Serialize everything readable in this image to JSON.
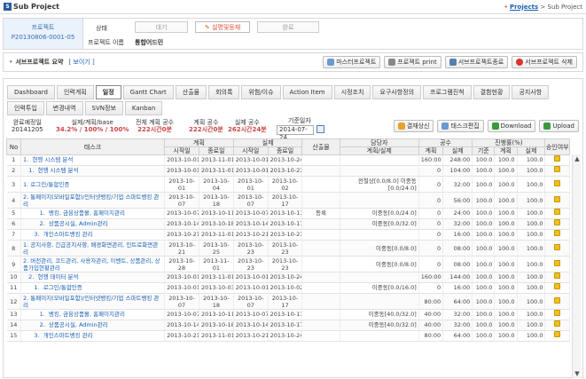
{
  "app": {
    "logo": "S",
    "title": "Sub Project"
  },
  "breadcrumb": {
    "link": "Projects",
    "sep": ">",
    "current": "Sub Project"
  },
  "project": {
    "label": "프로젝트",
    "code": "P20130806-0001-05",
    "status_label": "상태",
    "name_label": "프로젝트 이름",
    "name": "통합어드민",
    "steps": [
      "대기",
      "설명및등재",
      "완료"
    ],
    "active_step": 1
  },
  "summary": {
    "title": "서브프로젝트 요약",
    "show_link": "[ 보이기 ]",
    "buttons": [
      "마스터프로젝트",
      "프로젝트 print",
      "서브프로젝트종료",
      "서브프로젝트 삭제"
    ]
  },
  "tabs_row1": [
    "Dashboard",
    "인력계획",
    "일정",
    "Gantt Chart",
    "산출물",
    "회의록",
    "위험/이슈",
    "Action Item",
    "시정조치",
    "요구사항정의",
    "프로그램진척",
    "결함현황",
    "공지사항"
  ],
  "tabs_row2": [
    "인력투입",
    "변경내역",
    "SVN정보",
    "Kanban"
  ],
  "selected_tab": "일정",
  "stats": {
    "plan_end_label": "완료예정일",
    "plan_end": "20141205",
    "progress_label": "실제/계획/base",
    "progress": "34.2% / 100% / 100%",
    "total_label": "전체 계획 공수",
    "total": "222시간0분",
    "plan_label": "계획 공수",
    "plan": "222시간0분",
    "actual_label": "실제 공수",
    "actual": "262시간24분",
    "base_label": "기준일자",
    "base_date": "2014-07-24",
    "buttons": [
      "결재상신",
      "태스크편집",
      "Download",
      "Upload"
    ]
  },
  "table": {
    "headers": {
      "no": "No",
      "task": "태스크",
      "plan": "계획",
      "actual": "실제",
      "start": "시작일",
      "end": "종료일",
      "output": "산출물",
      "owner": "담당자",
      "owner_sub": "계획/실제",
      "effort": "공수",
      "effort_plan": "계획",
      "effort_actual": "실제",
      "progress": "진행률(%)",
      "p_base": "기준",
      "p_plan": "계획",
      "p_actual": "실제",
      "approve": "승인여부"
    },
    "rows": [
      {
        "no": "1",
        "task": "1.  현행 시스템 분석",
        "ps": "2013-10-01",
        "pe": "2013-11-01",
        "as": "2013-10-01",
        "ae": "2013-10-24",
        "out": "",
        "owner": "",
        "ep": "160:00",
        "ea": "248:00",
        "b": "100.0",
        "p": "100.0",
        "a": "100.0"
      },
      {
        "no": "2",
        "task": "   1.  현행 시스템 분석",
        "ps": "2013-10-01",
        "pe": "2013-11-01",
        "as": "2013-10-01",
        "ae": "2013-10-23",
        "out": "",
        "owner": "",
        "ep": "0",
        "ea": "104:00",
        "b": "100.0",
        "p": "100.0",
        "a": "100.0"
      },
      {
        "no": "3",
        "task": "      1.  로그인/통합인증",
        "ps": "2013-10-01",
        "pe": "2013-10-04",
        "as": "2013-10-01",
        "ae": "2013-10-02",
        "out": "",
        "owner": "전철상[0.0/8.0] 이중동[0.0/24.0]",
        "ep": "0",
        "ea": "32:00",
        "b": "100.0",
        "p": "100.0",
        "a": "100.0"
      },
      {
        "no": "4",
        "task": "      2.  통페이지(모바일포함)/인터넷뱅킹/기업 스마트뱅킹 관리",
        "ps": "2013-10-07",
        "pe": "2013-10-18",
        "as": "2013-10-07",
        "ae": "2013-10-17",
        "out": "",
        "owner": "",
        "ep": "0",
        "ea": "56:00",
        "b": "100.0",
        "p": "100.0",
        "a": "100.0"
      },
      {
        "no": "5",
        "task": "         1.  뱅킹, 금융상품몰, 홈페이지관리",
        "ps": "2013-10-07",
        "pe": "2013-10-11",
        "as": "2013-10-07",
        "ae": "2013-10-11",
        "out": "등록",
        "owner": "이중동[0.0/24.0]",
        "ep": "0",
        "ea": "24:00",
        "b": "100.0",
        "p": "100.0",
        "a": "100.0"
      },
      {
        "no": "6",
        "task": "         2.  상품공시실, Admin관리",
        "ps": "2013-10-14",
        "pe": "2013-10-18",
        "as": "2013-10-14",
        "ae": "2013-10-17",
        "out": "",
        "owner": "이중동[0.0/32.0]",
        "ep": "0",
        "ea": "32:00",
        "b": "100.0",
        "p": "100.0",
        "a": "100.0"
      },
      {
        "no": "7",
        "task": "      3.  개인스마트뱅킹 관리",
        "ps": "2013-10-21",
        "pe": "2013-11-01",
        "as": "2013-10-21",
        "ae": "2013-10-23",
        "out": "",
        "owner": "",
        "ep": "0",
        "ea": "16:00",
        "b": "100.0",
        "p": "100.0",
        "a": "100.0"
      },
      {
        "no": "8",
        "task": "         1.  공지사항, 긴급공지사항, 배경화면관리, 인트로화면관리",
        "ps": "2013-10-21",
        "pe": "2013-10-25",
        "as": "2013-10-23",
        "ae": "2013-10-23",
        "out": "",
        "owner": "이중동[0.0/8.0]",
        "ep": "0",
        "ea": "08:00",
        "b": "100.0",
        "p": "100.0",
        "a": "100.0"
      },
      {
        "no": "9",
        "task": "         2.  버전관리, 코드관리, 사용자관리, 이벤트, 상품관리, 상품가입현황관리",
        "ps": "2013-10-28",
        "pe": "2013-11-01",
        "as": "2013-10-23",
        "ae": "2013-10-23",
        "out": "",
        "owner": "이중동[0.0/8.0]",
        "ep": "0",
        "ea": "08:00",
        "b": "100.0",
        "p": "100.0",
        "a": "100.0"
      },
      {
        "no": "10",
        "task": "   2.  현행 데이터 분석",
        "ps": "2013-10-01",
        "pe": "2013-11-01",
        "as": "2013-10-01",
        "ae": "2013-10-24",
        "out": "",
        "owner": "",
        "ep": "160:00",
        "ea": "144:00",
        "b": "100.0",
        "p": "100.0",
        "a": "100.0"
      },
      {
        "no": "11",
        "task": "      1.  로그인/통합인증",
        "ps": "2013-10-01",
        "pe": "2013-10-03",
        "as": "2013-10-01",
        "ae": "2013-10-02",
        "out": "",
        "owner": "이중동[0.0/16.0]",
        "ep": "0",
        "ea": "16:00",
        "b": "100.0",
        "p": "100.0",
        "a": "100.0"
      },
      {
        "no": "12",
        "task": "      2.  통페이지(모바일포함)/인터넷뱅킹/기업 스마트뱅킹 관리",
        "ps": "2013-10-07",
        "pe": "2013-10-18",
        "as": "2013-10-07",
        "ae": "2013-10-17",
        "out": "",
        "owner": "",
        "ep": "80:00",
        "ea": "64:00",
        "b": "100.0",
        "p": "100.0",
        "a": "100.0"
      },
      {
        "no": "13",
        "task": "         1.  뱅킹, 금융상품몰, 홈페이지관리",
        "ps": "2013-10-07",
        "pe": "2013-10-11",
        "as": "2013-10-07",
        "ae": "2013-10-11",
        "out": "",
        "owner": "이중동[40.0/32.0]",
        "ep": "40:00",
        "ea": "32:00",
        "b": "100.0",
        "p": "100.0",
        "a": "100.0"
      },
      {
        "no": "14",
        "task": "         2.  상품공시실, Admin관리",
        "ps": "2013-10-14",
        "pe": "2013-10-18",
        "as": "2013-10-14",
        "ae": "2013-10-17",
        "out": "",
        "owner": "이중동[40.0/32.0]",
        "ep": "40:00",
        "ea": "32:00",
        "b": "100.0",
        "p": "100.0",
        "a": "100.0"
      },
      {
        "no": "15",
        "task": "      3.  개인스마트뱅킹 관리",
        "ps": "2013-10-21",
        "pe": "2013-11-01",
        "as": "2013-10-21",
        "ae": "2013-10-24",
        "out": "",
        "owner": "",
        "ep": "80:00",
        "ea": "64:00",
        "b": "100.0",
        "p": "100.0",
        "a": "100.0"
      }
    ]
  }
}
